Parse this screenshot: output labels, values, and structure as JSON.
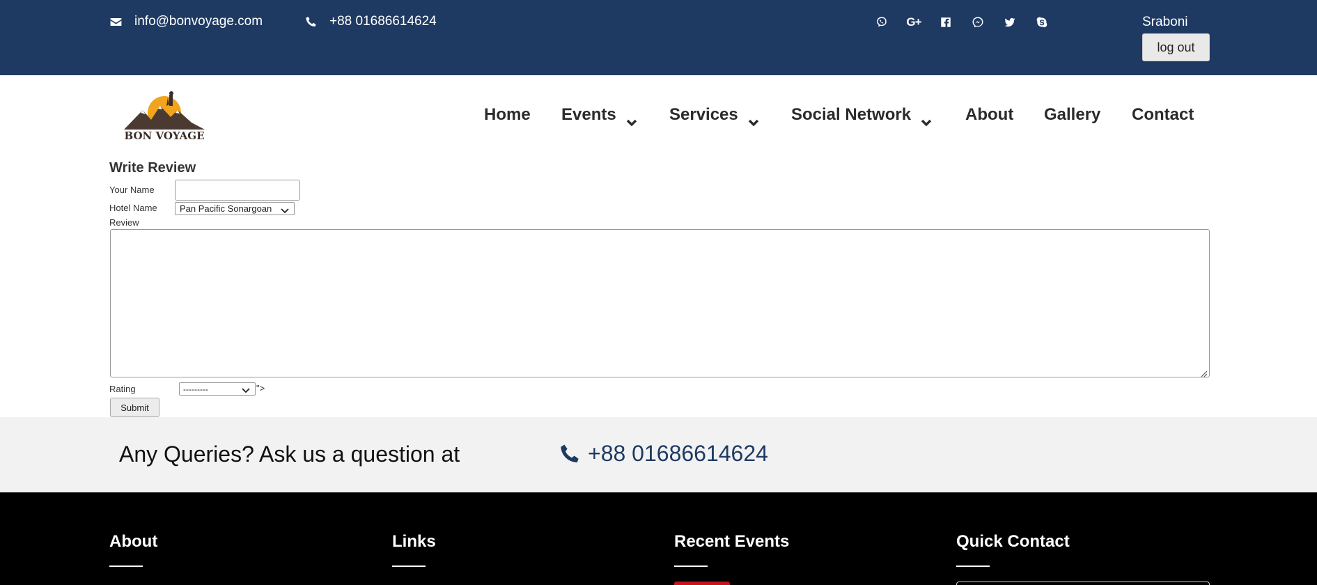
{
  "topbar": {
    "email": "info@bonvoyage.com",
    "phone": "+88 01686614624",
    "social_icons": [
      "viber-icon",
      "google-plus-icon",
      "facebook-icon",
      "messenger-icon",
      "twitter-icon",
      "skype-icon"
    ],
    "google_plus_text": "G+",
    "username": "Sraboni",
    "logout_label": "log out"
  },
  "brand": {
    "logo_text": "BON VOYAGE"
  },
  "nav": {
    "items": [
      {
        "label": "Home",
        "dropdown": false
      },
      {
        "label": "Events",
        "dropdown": true
      },
      {
        "label": "Services",
        "dropdown": true
      },
      {
        "label": "Social Network",
        "dropdown": true
      },
      {
        "label": "About",
        "dropdown": false
      },
      {
        "label": "Gallery",
        "dropdown": false
      },
      {
        "label": "Contact",
        "dropdown": false
      }
    ]
  },
  "form": {
    "title": "Write Review",
    "name_label": "Your Name",
    "name_value": "",
    "hotel_label": "Hotel Name",
    "hotel_selected": "Pan Pacific Sonargoan",
    "review_label": "Review",
    "review_value": "",
    "rating_label": "Rating",
    "rating_selected": "---------",
    "stray_text": "\">",
    "submit_label": "Submit"
  },
  "queries": {
    "text": "Any Queries? Ask us a question at",
    "phone": "+88 01686614624"
  },
  "footer": {
    "columns": [
      "About",
      "Links",
      "Recent Events",
      "Quick Contact"
    ]
  },
  "colors": {
    "topbar_bg": "#1e3a63",
    "queries_bg": "#f2f2f2",
    "footer_bg": "#000000",
    "accent_red": "#c5141a"
  }
}
